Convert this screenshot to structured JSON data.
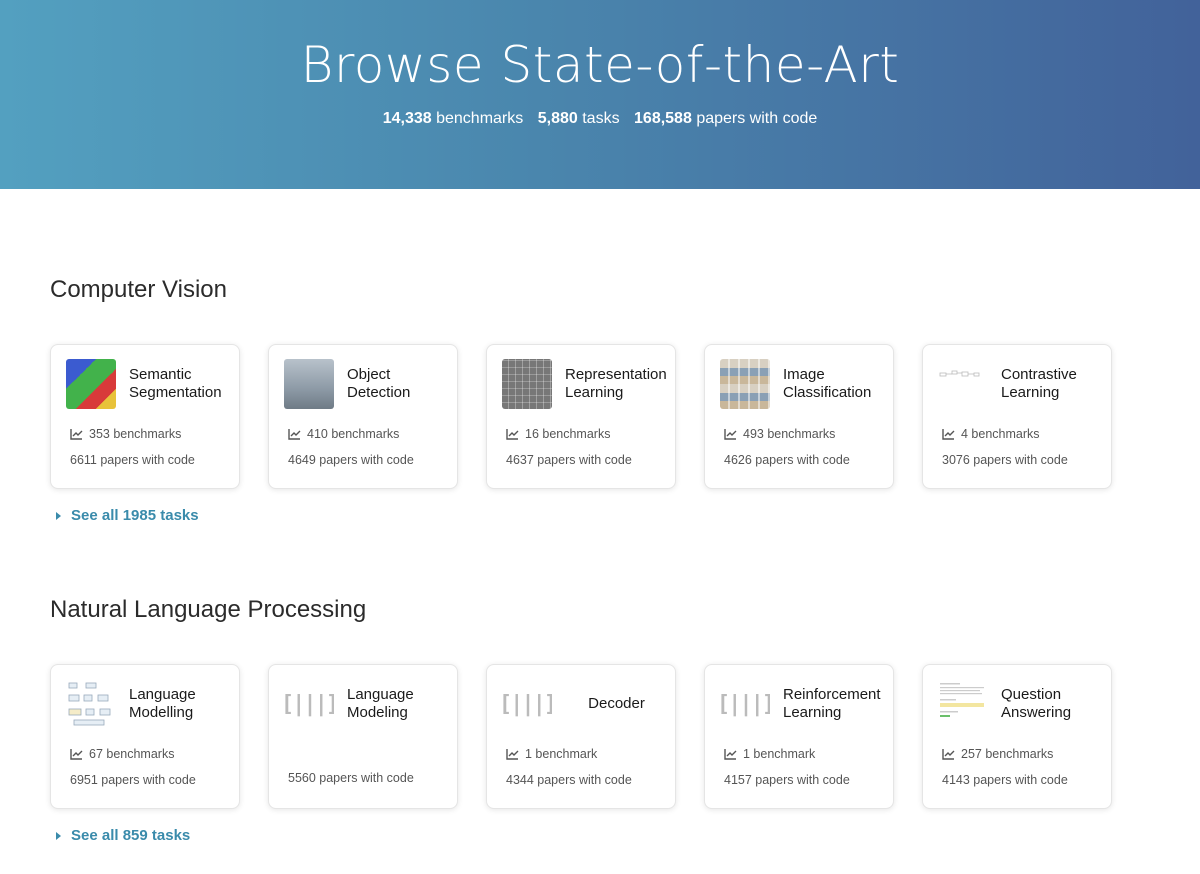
{
  "hero": {
    "title": "Browse State-of-the-Art",
    "stats": [
      {
        "value": "14,338",
        "label": "benchmarks"
      },
      {
        "value": "5,880",
        "label": "tasks"
      },
      {
        "value": "168,588",
        "label": "papers with code"
      }
    ]
  },
  "sections": [
    {
      "title": "Computer Vision",
      "see_all": "See all 1985 tasks",
      "cards": [
        {
          "title": "Semantic Segmentation",
          "benchmarks": "353 benchmarks",
          "papers": "6611 papers with code",
          "thumb": "segmentation-thumbnail"
        },
        {
          "title": "Object Detection",
          "benchmarks": "410 benchmarks",
          "papers": "4649 papers with code",
          "thumb": "detection-thumbnail"
        },
        {
          "title": "Representation Learning",
          "benchmarks": "16 benchmarks",
          "papers": "4637 papers with code",
          "thumb": "representation-thumbnail"
        },
        {
          "title": "Image Classification",
          "benchmarks": "493 benchmarks",
          "papers": "4626 papers with code",
          "thumb": "classification-thumbnail"
        },
        {
          "title": "Contrastive Learning",
          "benchmarks": "4 benchmarks",
          "papers": "3076 papers with code",
          "thumb": "contrastive-thumbnail"
        }
      ]
    },
    {
      "title": "Natural Language Processing",
      "see_all": "See all 859 tasks",
      "cards": [
        {
          "title": "Language Modelling",
          "benchmarks": "67 benchmarks",
          "papers": "6951 papers with code",
          "thumb": "language-modelling-thumbnail"
        },
        {
          "title": "Language Modeling",
          "benchmarks": "",
          "papers": "5560 papers with code",
          "thumb": "placeholder-barcode-icon"
        },
        {
          "title": "Decoder",
          "benchmarks": "1 benchmark",
          "papers": "4344 papers with code",
          "thumb": "placeholder-barcode-icon"
        },
        {
          "title": "Reinforcement Learning",
          "benchmarks": "1 benchmark",
          "papers": "4157 papers with code",
          "thumb": "placeholder-barcode-icon"
        },
        {
          "title": "Question Answering",
          "benchmarks": "257 benchmarks",
          "papers": "4143 papers with code",
          "thumb": "question-answering-thumbnail"
        }
      ]
    }
  ],
  "colors": {
    "link": "#3a8bab",
    "hero_start": "#53a0c0",
    "hero_end": "#42629a"
  }
}
